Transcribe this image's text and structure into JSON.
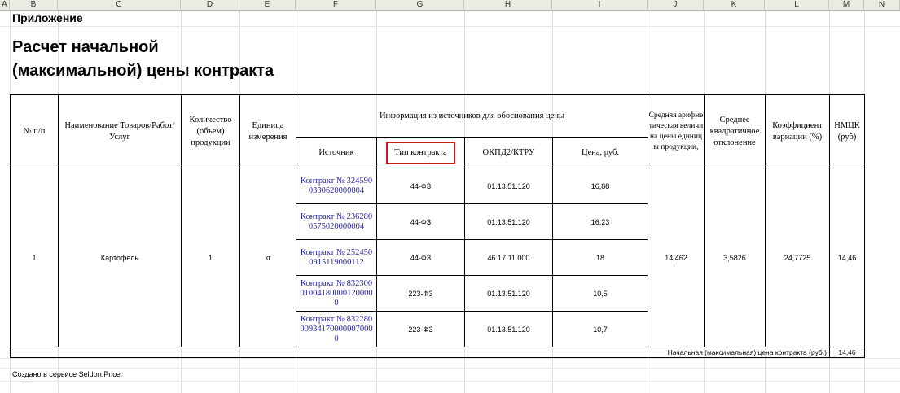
{
  "columns": [
    "A",
    "B",
    "C",
    "D",
    "E",
    "F",
    "G",
    "H",
    "I",
    "J",
    "K",
    "L",
    "M",
    "N"
  ],
  "appendix_title": "Приложение",
  "title": "Расчет начальной\n(максимальной) цены контракта",
  "table": {
    "headers": {
      "num": "№ п/п",
      "name": "Наименование Товаров/Работ/Услуг",
      "qty": "Количество (объем) продукции",
      "unit": "Единица измерения",
      "info": "Информация из источников для обоснования цены",
      "source": "Источник",
      "contract_type": "Тип контракта",
      "okpd": "ОКПД2/КТРУ",
      "price": "Цена, руб.",
      "avg": "Средняя арифметическая величина цены единицы продукции,",
      "stddev": "Среднее квадратичное отклонение",
      "variation": "Коэффициент вариации (%)",
      "nmck": "НМЦК (руб)"
    },
    "item": {
      "num": "1",
      "name": "Картофель",
      "qty": "1",
      "unit": "кг",
      "avg": "14,462",
      "stddev": "3,5826",
      "variation": "24,7725",
      "nmck": "14,46"
    },
    "sources": [
      {
        "source": "Контракт № 3245900330620000004",
        "type": "44-ФЗ",
        "okpd": "01.13.51.120",
        "price": "16,88"
      },
      {
        "source": "Контракт № 2362800575020000004",
        "type": "44-ФЗ",
        "okpd": "01.13.51.120",
        "price": "16,23"
      },
      {
        "source": "Контракт № 2524500915119000112",
        "type": "44-ФЗ",
        "okpd": "46.17.11.000",
        "price": "18"
      },
      {
        "source": "Контракт № 832300010041800001200000",
        "type": "223-ФЗ",
        "okpd": "01.13.51.120",
        "price": "10,5"
      },
      {
        "source": "Контракт № 832280009341700000070000",
        "type": "223-ФЗ",
        "okpd": "01.13.51.120",
        "price": "10,7"
      }
    ],
    "total_label": "Начальная (максимальная) цена контракта (руб.)",
    "total_value": "14,46"
  },
  "footer": "Создано в сервисе Seldon.Price."
}
